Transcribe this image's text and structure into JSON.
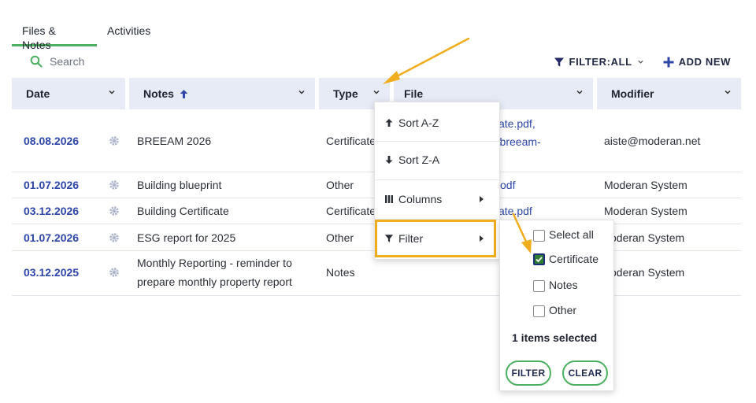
{
  "tabs": [
    {
      "label": "Files & Notes",
      "active": true
    },
    {
      "label": "Activities",
      "active": false
    }
  ],
  "search": {
    "placeholder": "Search"
  },
  "toolbar": {
    "filter_label": "FILTER:ALL",
    "add_label": "ADD NEW"
  },
  "columns": [
    "Date",
    "Notes",
    "Type",
    "File",
    "Modifier"
  ],
  "rows": [
    {
      "date": "08.08.2026",
      "notes_lines": [
        "BREEAM 2026"
      ],
      "type": "Certificate",
      "file_lines": [
        "ficate.pdf,",
        "m/breeam-"
      ],
      "modifier": "aiste@moderan.net"
    },
    {
      "date": "01.07.2026",
      "notes_lines": [
        "Building blueprint"
      ],
      "type": "Other",
      "file_lines": [
        "odf"
      ],
      "modifier": "Moderan System"
    },
    {
      "date": "03.12.2026",
      "notes_lines": [
        "Building Certificate"
      ],
      "type": "Certificate",
      "file_lines": [
        "ficate.pdf"
      ],
      "modifier": "Moderan System"
    },
    {
      "date": "01.07.2026",
      "notes_lines": [
        "ESG report for 2025"
      ],
      "type": "Other",
      "file_lines": [],
      "modifier": "oderan System"
    },
    {
      "date": "03.12.2025",
      "notes_lines": [
        "Monthly Reporting - reminder to",
        "prepare monthly property report"
      ],
      "type": "Notes",
      "file_lines": [],
      "modifier": "oderan System"
    }
  ],
  "column_menu": {
    "sort_asc": "Sort A-Z",
    "sort_desc": "Sort Z-A",
    "columns": "Columns",
    "filter": "Filter"
  },
  "filter_panel": {
    "options": [
      {
        "label": "Select all",
        "checked": false
      },
      {
        "label": "Certificate",
        "checked": true
      },
      {
        "label": "Notes",
        "checked": false
      },
      {
        "label": "Other",
        "checked": false
      }
    ],
    "selected_text": "1 items selected",
    "filter_button": "FILTER",
    "clear_button": "CLEAR"
  },
  "colors": {
    "accent_green": "#4caf62",
    "link_blue": "#2d46a8",
    "header_bg": "#e7ebf5",
    "annotation_orange": "#f0ad1e"
  }
}
